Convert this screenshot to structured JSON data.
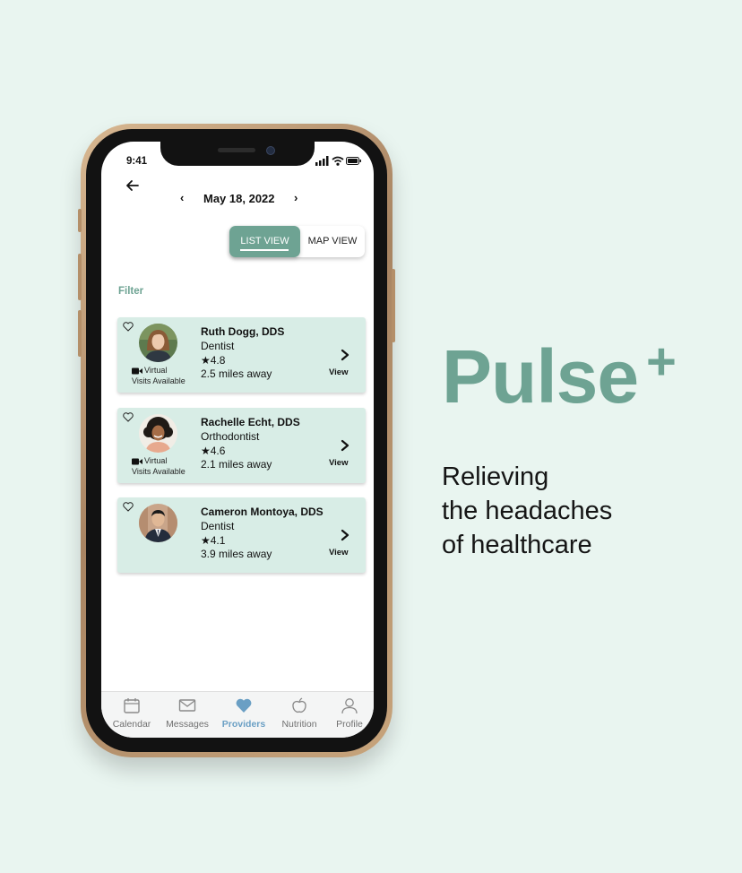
{
  "colors": {
    "background": "#e9f5f0",
    "accent": "#6ea393",
    "card": "#d8ede6",
    "active_tab": "#6a9fc4"
  },
  "status_bar": {
    "time": "9:41",
    "icons": [
      "signal-icon",
      "wifi-icon",
      "battery-icon"
    ]
  },
  "header": {
    "back_icon": "arrow-left-icon",
    "prev": "‹",
    "date": "May 18, 2022",
    "next": "›"
  },
  "view_toggle": {
    "list_label": "LIST VIEW",
    "map_label": "MAP VIEW",
    "selected": "LIST VIEW"
  },
  "filter_label": "Filter",
  "providers": [
    {
      "name": "Ruth Dogg, DDS",
      "specialty": "Dentist",
      "rating": "★4.8",
      "distance": "2.5 miles away",
      "virtual_line1": "Virtual",
      "virtual_line2": "Visits Available",
      "view_label": "View"
    },
    {
      "name": "Rachelle Echt, DDS",
      "specialty": "Orthodontist",
      "rating": "★4.6",
      "distance": "2.1 miles away",
      "virtual_line1": "Virtual",
      "virtual_line2": "Visits Available",
      "view_label": "View"
    },
    {
      "name": "Cameron Montoya, DDS",
      "specialty": "Dentist",
      "rating": "★4.1",
      "distance": "3.9 miles away",
      "view_label": "View"
    }
  ],
  "tab_bar": {
    "active": "Providers",
    "tabs": [
      {
        "label": "Calendar",
        "icon": "calendar-icon"
      },
      {
        "label": "Messages",
        "icon": "envelope-icon"
      },
      {
        "label": "Providers",
        "icon": "heart-icon"
      },
      {
        "label": "Nutrition",
        "icon": "apple-icon"
      },
      {
        "label": "Profile",
        "icon": "user-icon"
      }
    ]
  },
  "brand": {
    "name": "Pulse",
    "plus": "+",
    "tagline_lines": [
      "Relieving",
      "the headaches",
      "of healthcare"
    ]
  }
}
